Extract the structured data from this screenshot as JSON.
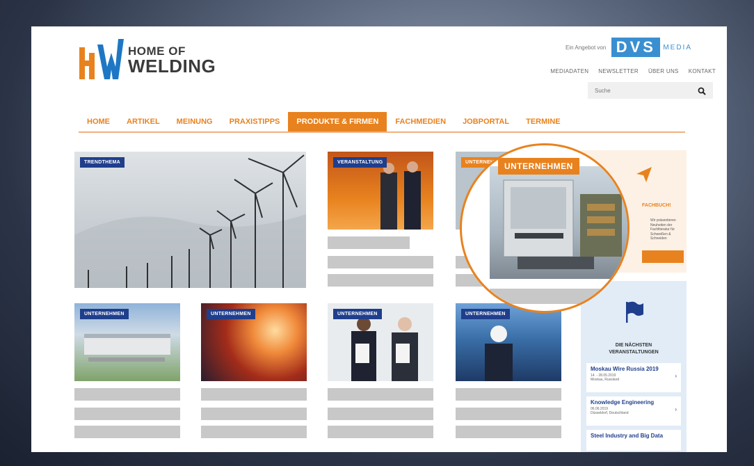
{
  "brand": {
    "logo_line1": "HOME OF",
    "logo_line2": "WELDING",
    "partner_prefix": "Ein Angebot von",
    "partner_logo": "DVS",
    "partner_media": "MEDIA"
  },
  "topnav": [
    "MEDIADATEN",
    "NEWSLETTER",
    "ÜBER UNS",
    "KONTAKT"
  ],
  "search": {
    "placeholder": "Suche",
    "icon": "search-icon"
  },
  "mainnav": {
    "items": [
      "HOME",
      "ARTIKEL",
      "MEINUNG",
      "PRAXISTIPPS",
      "PRODUKTE & FIRMEN",
      "FACHMEDIEN",
      "JOBPORTAL",
      "TERMINE"
    ],
    "active": "PRODUKTE & FIRMEN"
  },
  "cards": {
    "featured_badge": "TRENDTHEMA",
    "top2_badge": "VERANSTALTUNG",
    "top3_badge": "UNTERNEHMEN",
    "row2": [
      "UNTERNEHMEN",
      "UNTERNEHMEN",
      "UNTERNEHMEN",
      "UNTERNEHMEN"
    ]
  },
  "zoom": {
    "badge": "UNTERNEHMEN"
  },
  "sidebar": {
    "promo_title": "FACHBUCH!",
    "promo_text": "Wir präsentieren Neuheiten der Fachliteratur für Schweißen & Schneiden",
    "events_heading_1": "DIE NÄCHSTEN",
    "events_heading_2": "VERANSTALTUNGEN",
    "events": [
      {
        "title": "Moskau Wire Russia 2019",
        "date": "14. - 28.05.2019",
        "place": "Moskau, Russland"
      },
      {
        "title": "Knowledge Engineering",
        "date": "06.06.2019",
        "place": "Düsseldorf, Deutschland"
      },
      {
        "title": "Steel Industry and Big Data",
        "date": "",
        "place": ""
      }
    ]
  },
  "colors": {
    "accent": "#e8821e",
    "badge_blue": "#1f3e8c",
    "logo_blue": "#1e77c4",
    "placeholder_bar": "#c8c8c8"
  }
}
